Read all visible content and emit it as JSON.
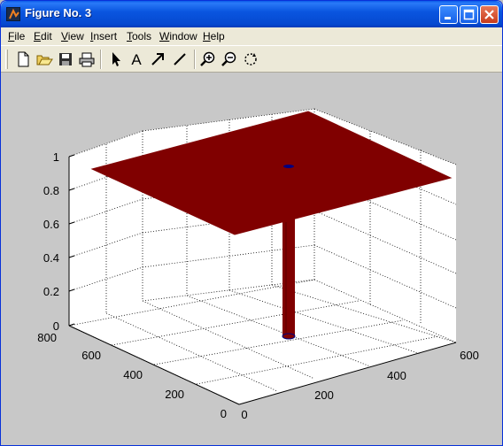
{
  "window": {
    "title": "Figure No. 3",
    "titlebar_color": "#0a56e0",
    "buttons": [
      "minimize",
      "maximize",
      "close"
    ]
  },
  "menu": {
    "items": [
      {
        "label": "File",
        "accel": "F",
        "rest": "ile"
      },
      {
        "label": "Edit",
        "accel": "E",
        "rest": "dit"
      },
      {
        "label": "View",
        "accel": "V",
        "rest": "iew"
      },
      {
        "label": "Insert",
        "accel": "I",
        "rest": "nsert"
      },
      {
        "label": "Tools",
        "accel": "T",
        "rest": "ools"
      },
      {
        "label": "Window",
        "accel": "W",
        "rest": "indow"
      },
      {
        "label": "Help",
        "accel": "H",
        "rest": "elp"
      }
    ]
  },
  "toolbar": {
    "tools": [
      {
        "name": "new-file-icon"
      },
      {
        "name": "open-folder-icon"
      },
      {
        "name": "save-icon"
      },
      {
        "name": "print-icon"
      },
      {
        "name": "select-arrow-icon"
      },
      {
        "name": "insert-text-icon",
        "glyph": "A"
      },
      {
        "name": "insert-arrow-icon"
      },
      {
        "name": "insert-line-icon"
      },
      {
        "name": "zoom-in-icon"
      },
      {
        "name": "zoom-out-icon"
      },
      {
        "name": "rotate-3d-icon"
      }
    ]
  },
  "chart_data": {
    "type": "surface",
    "z_ticks": [
      "0",
      "0.2",
      "0.4",
      "0.6",
      "0.8",
      "1"
    ],
    "y_ticks": [
      "0",
      "200",
      "400",
      "600",
      "800"
    ],
    "x_ticks": [
      "0",
      "200",
      "400",
      "600"
    ],
    "zlim": [
      0,
      1
    ],
    "grid": true,
    "surface_color": "#800000",
    "well_color": "#000080",
    "description_values": {
      "plateau_z": 1,
      "well_bottom_z": 0
    }
  }
}
